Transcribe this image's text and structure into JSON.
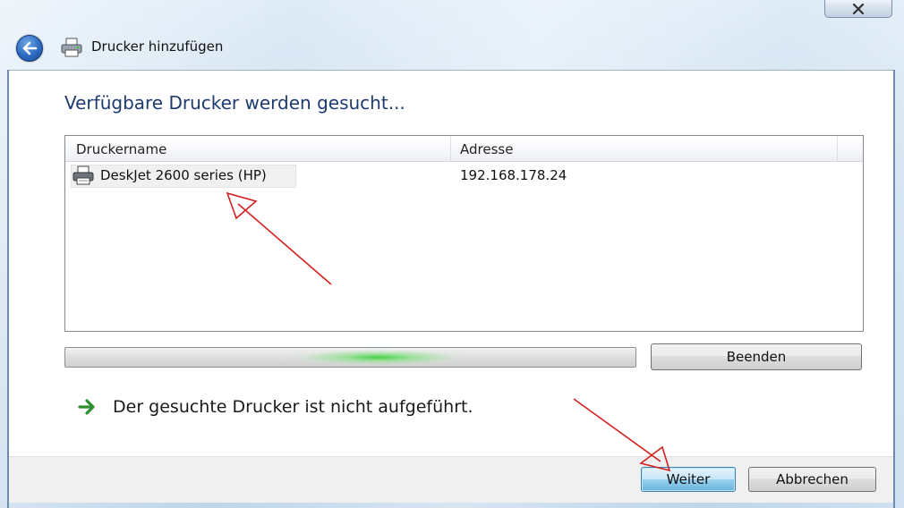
{
  "window": {
    "title": "Drucker hinzufügen",
    "close_icon": "close-x-icon"
  },
  "page": {
    "heading": "Verfügbare Drucker werden gesucht..."
  },
  "printer_list": {
    "columns": [
      "Druckername",
      "Adresse"
    ],
    "rows": [
      {
        "name": "DeskJet 2600 series (HP)",
        "address": "192.168.178.24",
        "icon": "printer-icon"
      }
    ]
  },
  "progress": {
    "state": "searching"
  },
  "buttons": {
    "stop": "Beenden",
    "next": "Weiter",
    "cancel": "Abbrechen"
  },
  "not_listed_link": "Der gesuchte Drucker ist nicht aufgeführt.",
  "colors": {
    "heading": "#1e3a6e",
    "annotation_arrow": "#d42020",
    "progress_glow": "#3cd23c"
  }
}
